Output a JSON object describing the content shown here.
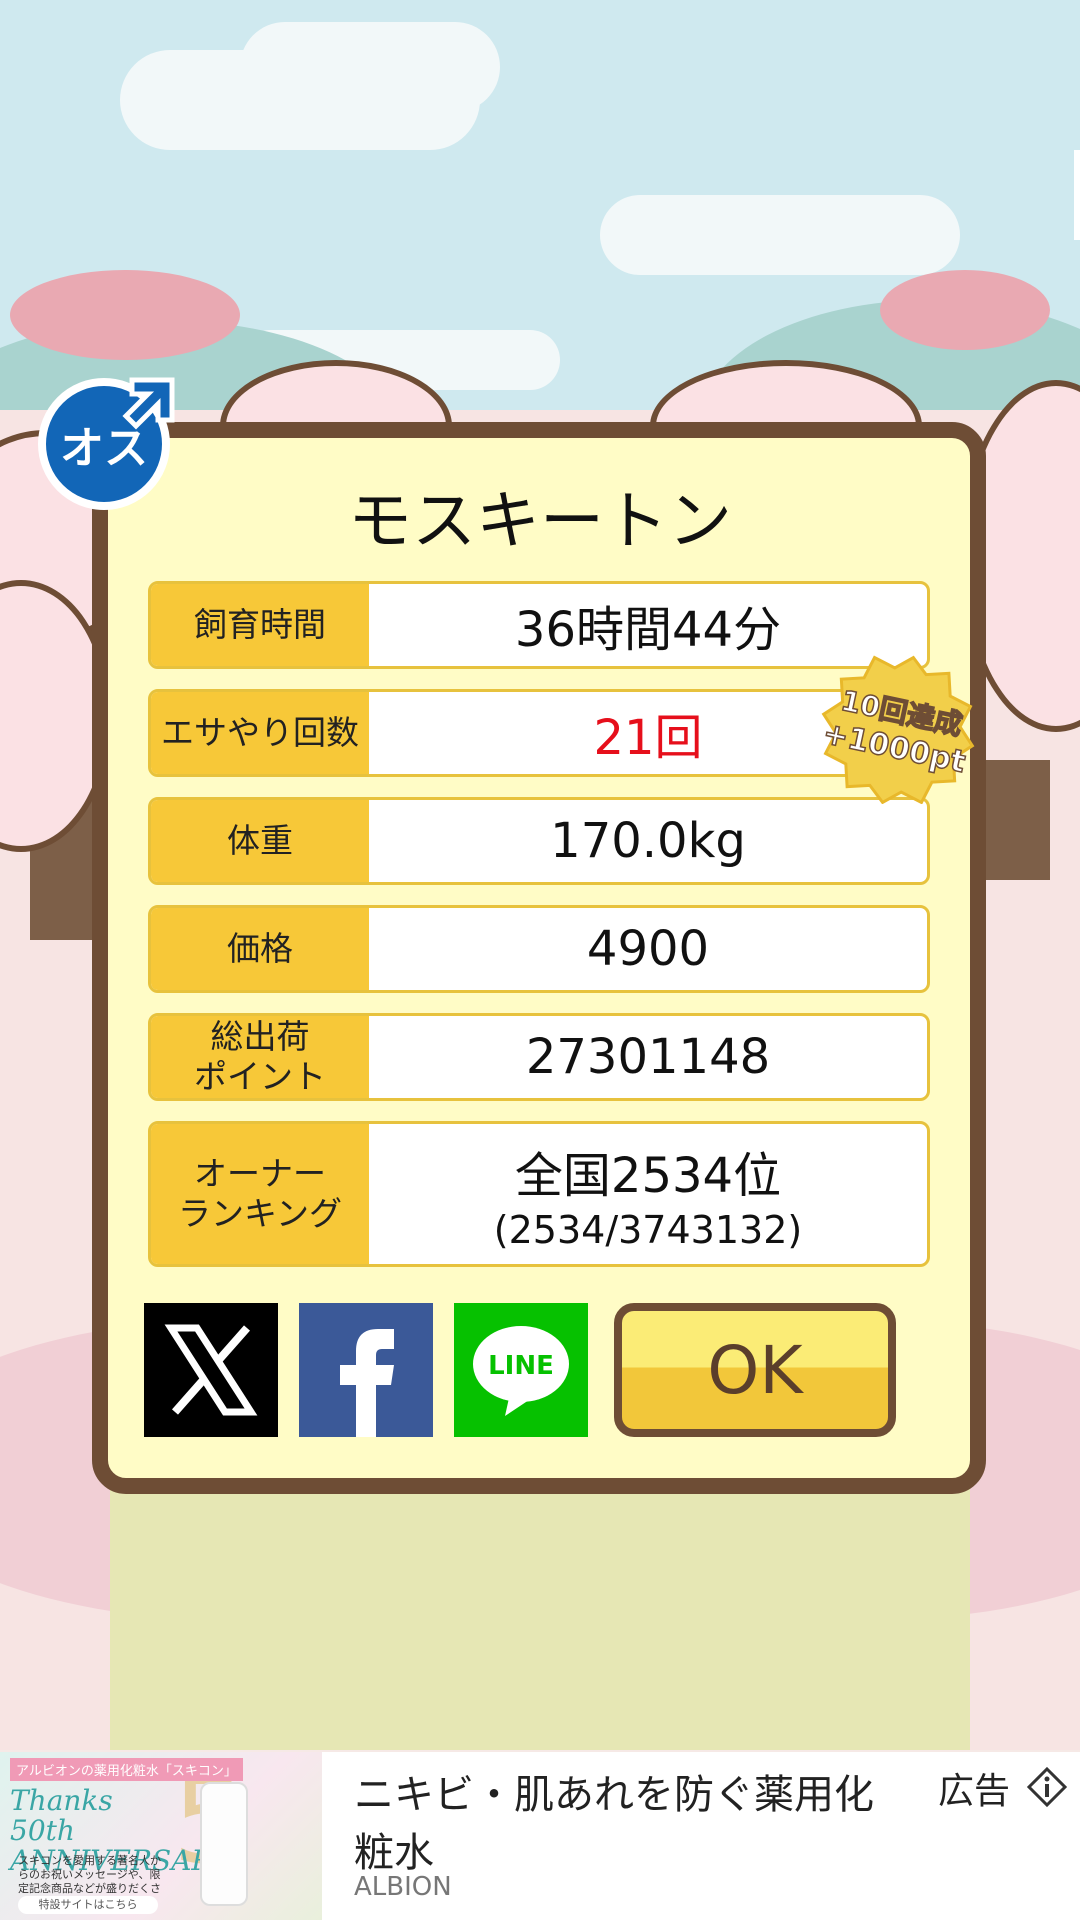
{
  "pet": {
    "name": "モスキートン",
    "gender_label": "オス"
  },
  "stats": [
    {
      "label": "飼育時間",
      "value": "36時間44分"
    },
    {
      "label": "エサやり回数",
      "value": "21回",
      "highlight": "#e60f1b"
    },
    {
      "label": "体重",
      "value": "170.0kg"
    },
    {
      "label": "価格",
      "value": "4900"
    },
    {
      "label": "総出荷\nポイント",
      "value": "27301148"
    },
    {
      "label": "オーナー\nランキング",
      "value": "全国2534位",
      "sub": "(2534/3743132)"
    }
  ],
  "badge": {
    "line1": "10回達成",
    "line2": "+1000pt"
  },
  "buttons": {
    "ok": "OK",
    "x_icon": "x-logo-icon",
    "facebook_icon": "facebook-logo-icon",
    "line": "LINE"
  },
  "ad": {
    "thumb_tag": "アルビオンの薬用化粧水「スキコン」",
    "thumb_title": "Thanks 50th ANNIVERSARY",
    "thumb_body": "スキコンを愛用する著名人からのお祝いメッセージや、限定記念商品などが盛りだくさん!",
    "thumb_button": "特設サイトはこちら",
    "headline": "ニキビ・肌あれを防ぐ薬用化粧水",
    "brand": "ALBION",
    "label": "広告"
  },
  "colors": {
    "frame": "#6e4d35",
    "panel": "#fffcc6",
    "label_bg": "#f7c838",
    "x": "#000000",
    "facebook": "#3b5998",
    "line": "#06c100"
  }
}
